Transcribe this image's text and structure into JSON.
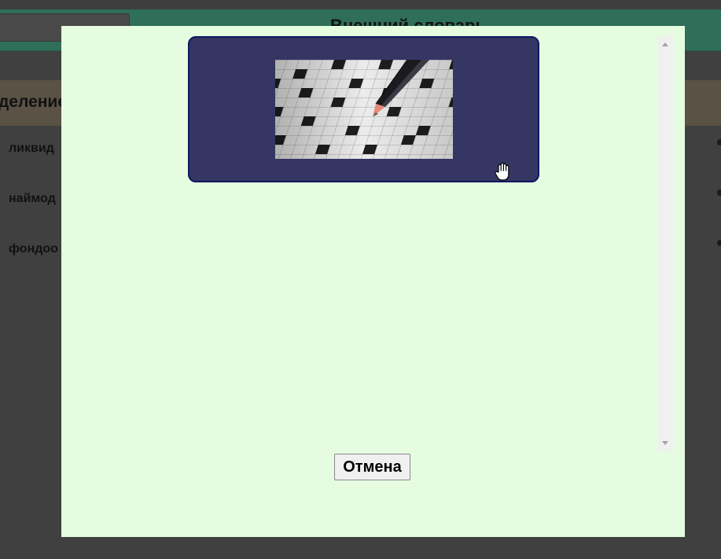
{
  "background": {
    "header_title": "Внешний словарь",
    "section_title": "деление",
    "words": [
      "ликвид",
      "наймод",
      "фондоо"
    ]
  },
  "modal": {
    "image_alt": "Кроссворд и карандаш",
    "cancel_label": "Отмена"
  },
  "colors": {
    "modal_background": "#e6fce1",
    "image_card": "#353663",
    "image_card_border": "#0e1860",
    "header": "#2f6e58",
    "overlay": "#404040"
  },
  "icons": {
    "cursor": "hand-pointer-icon",
    "scroll_up": "triangle-up-icon",
    "scroll_down": "triangle-down-icon"
  }
}
